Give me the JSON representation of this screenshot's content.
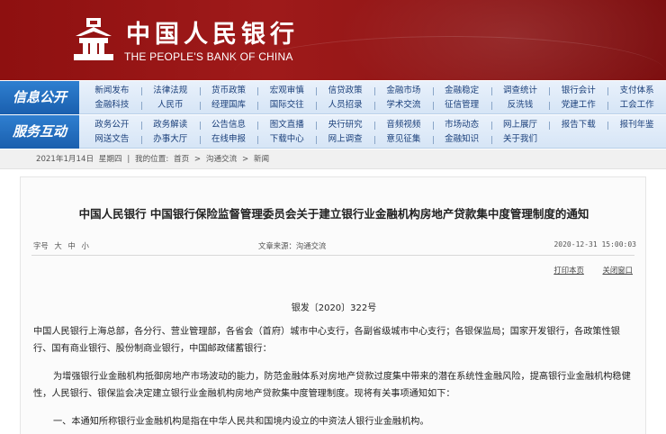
{
  "header": {
    "logo_cn": "中国人民银行",
    "logo_en": "THE PEOPLE'S BANK OF CHINA"
  },
  "nav": {
    "row1": {
      "label": "信息公开",
      "items": [
        "新闻发布",
        "法律法规",
        "货币政策",
        "宏观审慎",
        "信贷政策",
        "金融市场",
        "金融稳定",
        "调查统计",
        "银行会计",
        "支付体系",
        "金融科技",
        "人民币",
        "经理国库",
        "国际交往",
        "人员招录",
        "学术交流",
        "征信管理",
        "反洗钱",
        "党建工作",
        "工会工作"
      ]
    },
    "row2": {
      "label": "服务互动",
      "items": [
        "政务公开",
        "政务解读",
        "公告信息",
        "图文直播",
        "央行研究",
        "音频视频",
        "市场动态",
        "网上展厅",
        "报告下载",
        "报刊年鉴",
        "网送文告",
        "办事大厅",
        "在线申报",
        "下载中心",
        "网上调查",
        "意见征集",
        "金融知识",
        "关于我们",
        "",
        ""
      ]
    }
  },
  "breadcrumb": {
    "date": "2021年1月14日",
    "weekday": "星期四",
    "position_label": "我的位置:",
    "home": "首页",
    "section": "沟通交流",
    "current": "新闻",
    "sep": ">"
  },
  "article": {
    "title": "中国人民银行  中国银行保险监督管理委员会关于建立银行业金融机构房地产贷款集中度管理制度的通知",
    "font_size_label": "字号",
    "font_sizes": [
      "大",
      "中",
      "小"
    ],
    "source": "文章来源：沟通交流",
    "datetime": "2020-12-31 15:00:03",
    "print_label": "打印本页",
    "close_label": "关闭窗口",
    "doc_number": "银发〔2020〕322号",
    "para1": "中国人民银行上海总部，各分行、营业管理部，各省会（首府）城市中心支行，各副省级城市中心支行；各银保监局；国家开发银行，各政策性银行、国有商业银行、股份制商业银行，中国邮政储蓄银行：",
    "para2": "为增强银行业金融机构抵御房地产市场波动的能力，防范金融体系对房地产贷款过度集中带来的潜在系统性金融风险，提高银行业金融机构稳健性，人民银行、银保监会决定建立银行业金融机构房地产贷款集中度管理制度。现将有关事项通知如下：",
    "para3": "一、本通知所称银行业金融机构是指在中华人民共和国境内设立的中资法人银行业金融机构。"
  },
  "colors": {
    "banner": "#9f1a1a",
    "nav_label": "#1a5fae",
    "nav_bg": "#e9f1fb",
    "nav_text": "#1a3f7a"
  }
}
